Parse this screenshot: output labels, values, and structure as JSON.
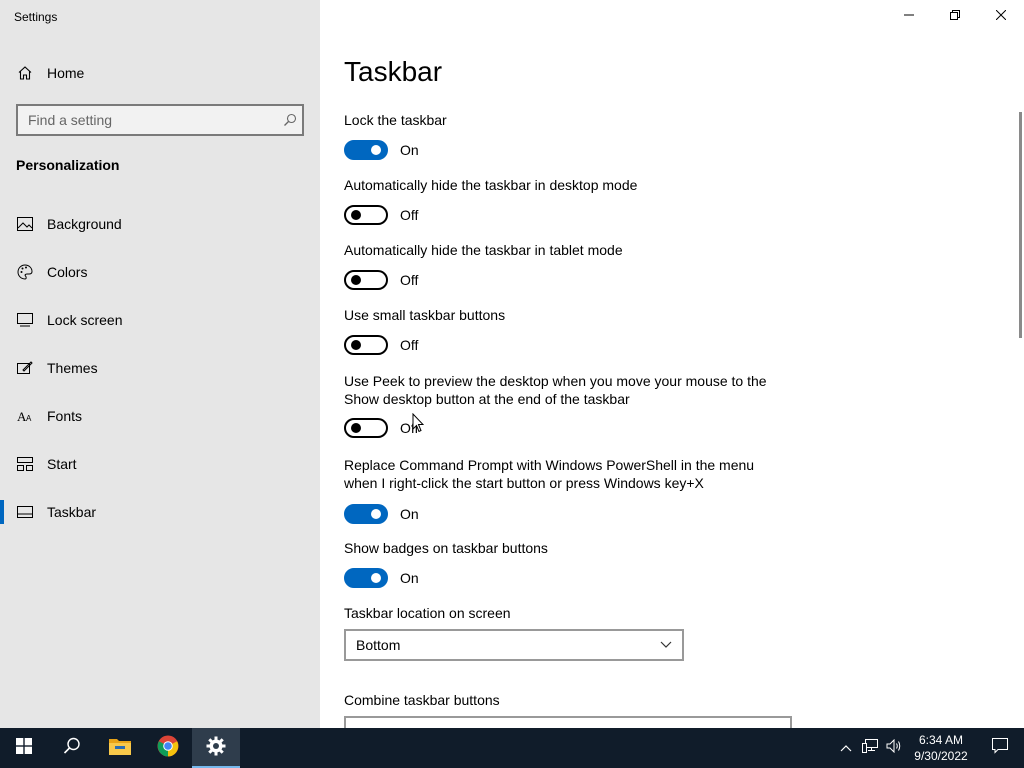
{
  "window": {
    "title": "Settings"
  },
  "sidebar": {
    "home_label": "Home",
    "search_placeholder": "Find a setting",
    "section_title": "Personalization",
    "items": [
      {
        "label": "Background",
        "icon": "image-icon"
      },
      {
        "label": "Colors",
        "icon": "palette-icon"
      },
      {
        "label": "Lock screen",
        "icon": "lock-screen-icon"
      },
      {
        "label": "Themes",
        "icon": "themes-icon"
      },
      {
        "label": "Fonts",
        "icon": "fonts-icon"
      },
      {
        "label": "Start",
        "icon": "start-icon"
      },
      {
        "label": "Taskbar",
        "icon": "taskbar-icon",
        "active": true
      }
    ]
  },
  "main": {
    "title": "Taskbar",
    "settings": [
      {
        "label": "Lock the taskbar",
        "state": "On",
        "on": true
      },
      {
        "label": "Automatically hide the taskbar in desktop mode",
        "state": "Off",
        "on": false
      },
      {
        "label": "Automatically hide the taskbar in tablet mode",
        "state": "Off",
        "on": false
      },
      {
        "label": "Use small taskbar buttons",
        "state": "Off",
        "on": false
      },
      {
        "label": "Use Peek to preview the desktop when you move your mouse to the Show desktop button at the end of the taskbar",
        "state": "Off",
        "on": false
      },
      {
        "label": "Replace Command Prompt with Windows PowerShell in the menu when I right-click the start button or press Windows key+X",
        "state": "On",
        "on": true
      },
      {
        "label": "Show badges on taskbar buttons",
        "state": "On",
        "on": true
      }
    ],
    "location_label": "Taskbar location on screen",
    "location_value": "Bottom",
    "combine_label": "Combine taskbar buttons"
  },
  "taskbar": {
    "apps": [
      "start-icon",
      "search-icon",
      "file-explorer-icon",
      "chrome-icon",
      "settings-icon"
    ],
    "clock_time": "6:34 AM",
    "clock_date": "9/30/2022"
  },
  "colors": {
    "accent": "#0067c0",
    "sidebar_bg": "#e6e6e6",
    "taskbar_bg": "#101c2a"
  }
}
